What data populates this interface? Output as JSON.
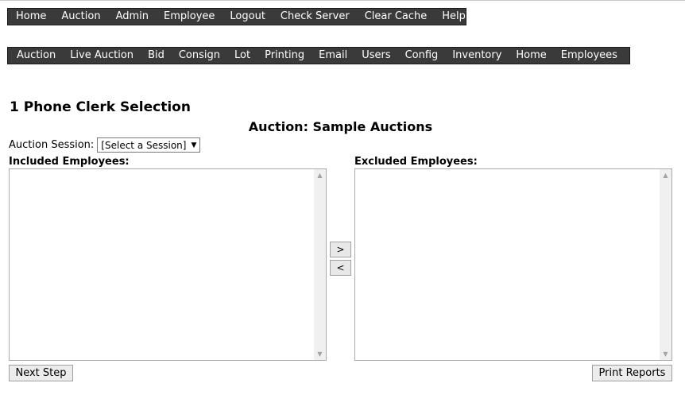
{
  "top_nav": [
    "Home",
    "Auction",
    "Admin",
    "Employee",
    "Logout",
    "Check Server",
    "Clear Cache",
    "Help"
  ],
  "sub_nav": [
    "Auction",
    "Live Auction",
    "Bid",
    "Consign",
    "Lot",
    "Printing",
    "Email",
    "Users",
    "Config",
    "Inventory",
    "Home",
    "Employees"
  ],
  "page": {
    "title": "1 Phone Clerk Selection",
    "auction_title": "Auction: Sample Auctions"
  },
  "session": {
    "label": "Auction Session:",
    "selected": "[Select a Session]"
  },
  "lists": {
    "included_label": "Included Employees:",
    "excluded_label": "Excluded Employees:",
    "included_items": [],
    "excluded_items": []
  },
  "buttons": {
    "move_right": ">",
    "move_left": "<",
    "next_step": "Next Step",
    "print_reports": "Print Reports"
  }
}
